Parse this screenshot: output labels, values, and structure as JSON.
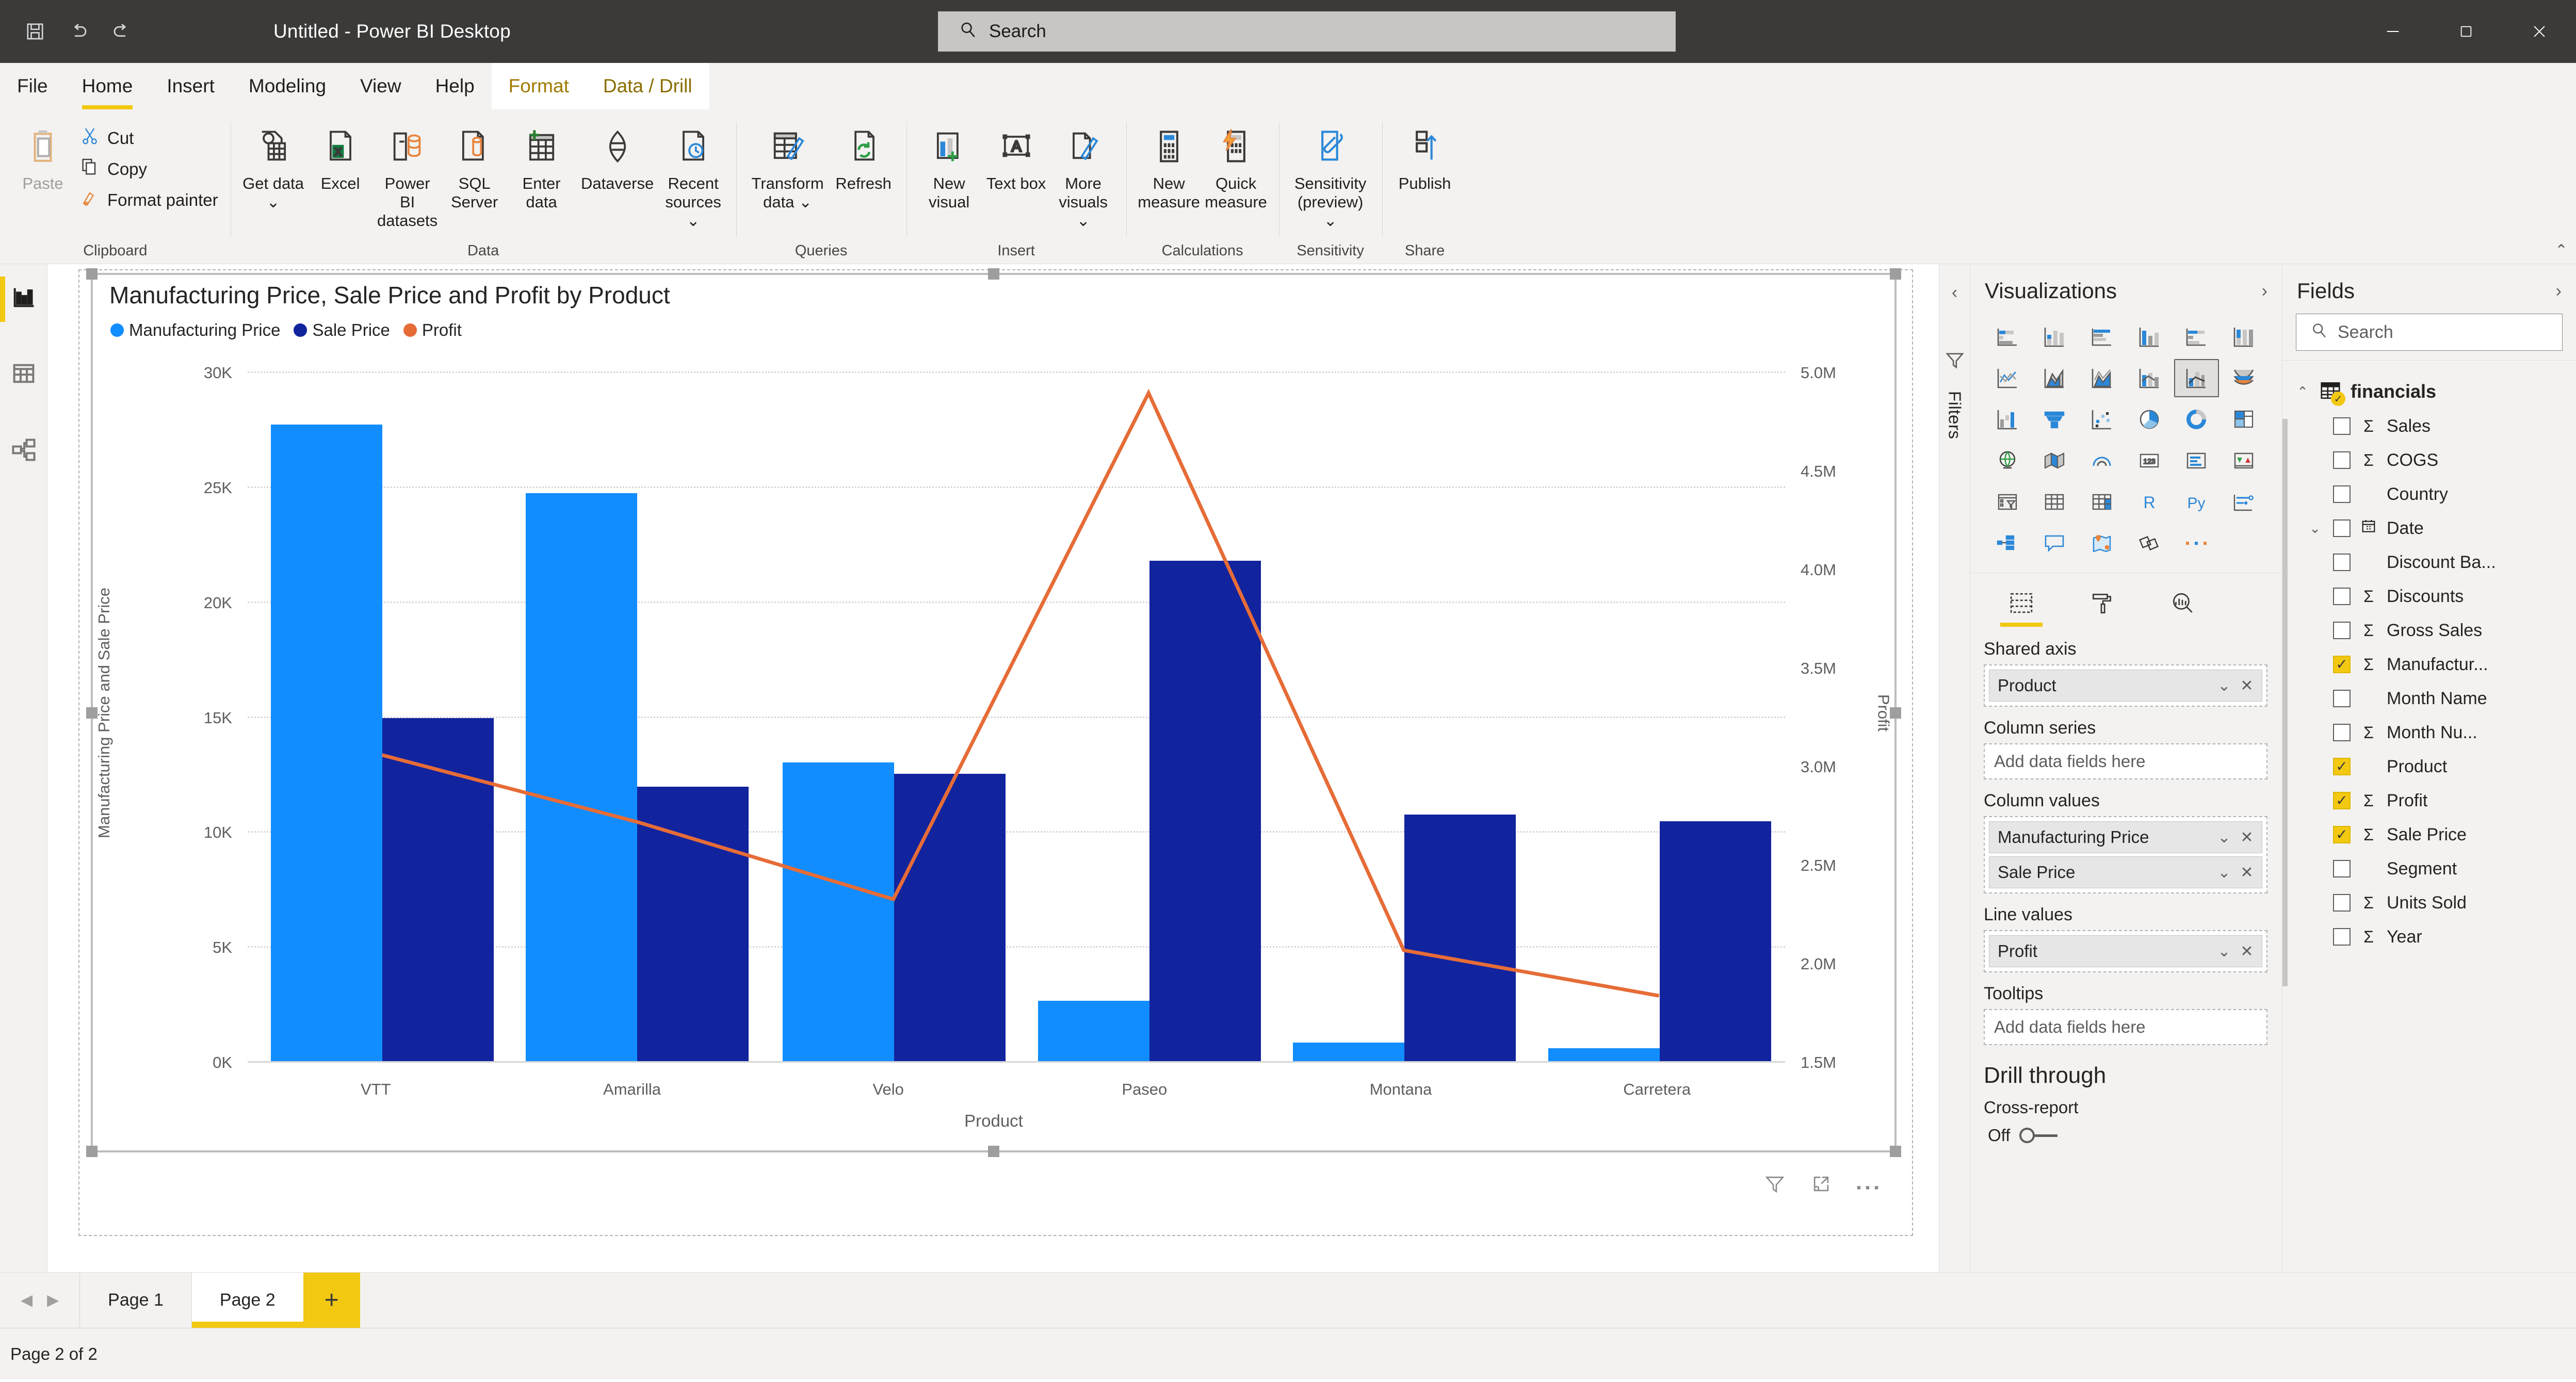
{
  "titlebar": {
    "app_title": "Untitled - Power BI Desktop",
    "save_icon": "save-icon",
    "undo_icon": "undo-icon",
    "redo_icon": "redo-icon",
    "search_placeholder": "Search",
    "minimize": "minimize-icon",
    "maximize": "maximize-icon",
    "close": "close-icon"
  },
  "ribbon_tabs": [
    {
      "label": "File",
      "state": "file"
    },
    {
      "label": "Home",
      "state": "active"
    },
    {
      "label": "Insert",
      "state": "normal"
    },
    {
      "label": "Modeling",
      "state": "normal"
    },
    {
      "label": "View",
      "state": "normal"
    },
    {
      "label": "Help",
      "state": "normal"
    },
    {
      "label": "Format",
      "state": "contextual-selected"
    },
    {
      "label": "Data / Drill",
      "state": "contextual"
    }
  ],
  "ribbon": {
    "groups": [
      {
        "name": "Clipboard",
        "label": "Clipboard",
        "big": [
          {
            "label": "Paste",
            "icon": "paste-icon",
            "disabled": true
          }
        ],
        "small": [
          {
            "label": "Cut",
            "icon": "cut-icon"
          },
          {
            "label": "Copy",
            "icon": "copy-icon"
          },
          {
            "label": "Format painter",
            "icon": "format-painter-icon"
          }
        ]
      },
      {
        "name": "Data",
        "label": "Data",
        "big": [
          {
            "label": "Get data",
            "icon": "get-data-icon",
            "caret": true
          },
          {
            "label": "Excel",
            "icon": "excel-icon"
          },
          {
            "label": "Power BI datasets",
            "icon": "powerbi-datasets-icon"
          },
          {
            "label": "SQL Server",
            "icon": "sql-server-icon"
          },
          {
            "label": "Enter data",
            "icon": "enter-data-icon"
          },
          {
            "label": "Dataverse",
            "icon": "dataverse-icon"
          },
          {
            "label": "Recent sources",
            "icon": "recent-sources-icon",
            "caret": true
          }
        ]
      },
      {
        "name": "Queries",
        "label": "Queries",
        "big": [
          {
            "label": "Transform data",
            "icon": "transform-data-icon",
            "caret": true
          },
          {
            "label": "Refresh",
            "icon": "refresh-icon"
          }
        ]
      },
      {
        "name": "Insert",
        "label": "Insert",
        "big": [
          {
            "label": "New visual",
            "icon": "new-visual-icon"
          },
          {
            "label": "Text box",
            "icon": "text-box-icon"
          },
          {
            "label": "More visuals",
            "icon": "more-visuals-icon",
            "caret": true
          }
        ]
      },
      {
        "name": "Calculations",
        "label": "Calculations",
        "big": [
          {
            "label": "New measure",
            "icon": "new-measure-icon"
          },
          {
            "label": "Quick measure",
            "icon": "quick-measure-icon"
          }
        ]
      },
      {
        "name": "Sensitivity",
        "label": "Sensitivity",
        "big": [
          {
            "label": "Sensitivity (preview)",
            "icon": "sensitivity-icon",
            "caret": true
          }
        ]
      },
      {
        "name": "Share",
        "label": "Share",
        "big": [
          {
            "label": "Publish",
            "icon": "publish-icon"
          }
        ]
      }
    ]
  },
  "left_rail": [
    {
      "name": "report-view",
      "icon": "bar-chart-icon",
      "active": true
    },
    {
      "name": "data-view",
      "icon": "table-icon",
      "active": false
    },
    {
      "name": "model-view",
      "icon": "model-relationship-icon",
      "active": false
    }
  ],
  "chart_data": {
    "type": "bar",
    "title": "Manufacturing Price, Sale Price and Profit by Product",
    "xlabel": "Product",
    "ylabel": "Manufacturing Price and Sale Price",
    "y2label": "Profit",
    "categories": [
      "VTT",
      "Amarilla",
      "Velo",
      "Paseo",
      "Montana",
      "Carretera"
    ],
    "series": [
      {
        "name": "Manufacturing Price",
        "type": "column",
        "axis": "left",
        "color": "#118dff",
        "values": [
          27750,
          24780,
          13050,
          2700,
          870,
          620
        ]
      },
      {
        "name": "Sale Price",
        "type": "column",
        "axis": "left",
        "color": "#12239e",
        "values": [
          15000,
          12000,
          12560,
          21850,
          10800,
          10500
        ]
      },
      {
        "name": "Profit",
        "type": "line",
        "axis": "right",
        "color": "#e66c37",
        "values": [
          3060000,
          2720000,
          2330000,
          4900000,
          2070000,
          1840000
        ]
      }
    ],
    "left_ticks": [
      "0K",
      "5K",
      "10K",
      "15K",
      "20K",
      "25K",
      "30K"
    ],
    "left_ylim": [
      0,
      30000
    ],
    "right_ticks": [
      "1.5M",
      "2.0M",
      "2.5M",
      "3.0M",
      "3.5M",
      "4.0M",
      "4.5M",
      "5.0M"
    ],
    "right_ylim": [
      1500000,
      5000000
    ],
    "grid": true,
    "legend_position": "top-left",
    "legend": [
      "Manufacturing Price",
      "Sale Price",
      "Profit"
    ]
  },
  "visual_toolbar": [
    {
      "name": "filter-icon"
    },
    {
      "name": "focus-mode-icon"
    },
    {
      "name": "more-options-icon"
    }
  ],
  "filters_rail": {
    "collapse_icon": "chevron-left-icon",
    "filter_icon": "filter-funnel-icon",
    "label": "Filters"
  },
  "visualizations": {
    "title": "Visualizations",
    "expand_icon": "chevron-right-icon",
    "gallery": [
      "stacked-bar-chart-icon",
      "stacked-column-chart-icon",
      "clustered-bar-chart-icon",
      "clustered-column-chart-icon",
      "100-stacked-bar-chart-icon",
      "100-stacked-column-chart-icon",
      "line-chart-icon",
      "area-chart-icon",
      "stacked-area-chart-icon",
      "line-and-stacked-column-chart-icon",
      "line-and-clustered-column-chart-icon",
      "ribbon-chart-icon",
      "waterfall-chart-icon",
      "funnel-chart-icon",
      "scatter-chart-icon",
      "pie-chart-icon",
      "donut-chart-icon",
      "treemap-icon",
      "map-icon",
      "filled-map-icon",
      "azure-map-icon",
      "card-icon",
      "multi-row-card-icon",
      "kpi-icon",
      "slicer-icon",
      "table-icon",
      "matrix-icon",
      "r-script-visual-icon",
      "python-visual-icon",
      "key-influencers-icon",
      "decomposition-tree-icon",
      "smart-narrative-icon",
      "arcgis-map-icon",
      "paginated-report-icon",
      "more-visuals-ellipsis-icon"
    ],
    "selected_gallery_index": 10,
    "modes": [
      {
        "name": "fields-pane-icon",
        "selected": true
      },
      {
        "name": "format-pane-icon",
        "selected": false
      },
      {
        "name": "analytics-pane-icon",
        "selected": false
      }
    ],
    "wells": [
      {
        "label": "Shared axis",
        "placeholder": "Add data fields here",
        "chips": [
          "Product"
        ]
      },
      {
        "label": "Column series",
        "placeholder": "Add data fields here",
        "chips": []
      },
      {
        "label": "Column values",
        "placeholder": "Add data fields here",
        "chips": [
          "Manufacturing Price",
          "Sale Price"
        ]
      },
      {
        "label": "Line values",
        "placeholder": "Add data fields here",
        "chips": [
          "Profit"
        ]
      },
      {
        "label": "Tooltips",
        "placeholder": "Add data fields here",
        "chips": []
      }
    ],
    "drill_through": {
      "heading": "Drill through",
      "cross_report_label": "Cross-report",
      "toggle_state": "Off"
    }
  },
  "fields": {
    "title": "Fields",
    "expand_icon": "chevron-right-icon",
    "search_placeholder": "Search",
    "search_icon": "search-icon",
    "table": {
      "name": "financials",
      "expanded": true,
      "icon": "table-badge-icon"
    },
    "items": [
      {
        "label": "Sales",
        "checked": false,
        "sigma": true,
        "icon": null,
        "expandable": false
      },
      {
        "label": "COGS",
        "checked": false,
        "sigma": true,
        "icon": null,
        "expandable": false
      },
      {
        "label": "Country",
        "checked": false,
        "sigma": false,
        "icon": null,
        "expandable": false
      },
      {
        "label": "Date",
        "checked": false,
        "sigma": false,
        "icon": "calendar-icon",
        "expandable": true
      },
      {
        "label": "Discount Ba...",
        "checked": false,
        "sigma": false,
        "icon": null,
        "expandable": false
      },
      {
        "label": "Discounts",
        "checked": false,
        "sigma": true,
        "icon": null,
        "expandable": false
      },
      {
        "label": "Gross Sales",
        "checked": false,
        "sigma": true,
        "icon": null,
        "expandable": false
      },
      {
        "label": "Manufactur...",
        "checked": true,
        "sigma": true,
        "icon": null,
        "expandable": false
      },
      {
        "label": "Month Name",
        "checked": false,
        "sigma": false,
        "icon": null,
        "expandable": false
      },
      {
        "label": "Month Nu...",
        "checked": false,
        "sigma": true,
        "icon": null,
        "expandable": false
      },
      {
        "label": "Product",
        "checked": true,
        "sigma": false,
        "icon": null,
        "expandable": false
      },
      {
        "label": "Profit",
        "checked": true,
        "sigma": true,
        "icon": null,
        "expandable": false
      },
      {
        "label": "Sale Price",
        "checked": true,
        "sigma": true,
        "icon": null,
        "expandable": false
      },
      {
        "label": "Segment",
        "checked": false,
        "sigma": false,
        "icon": null,
        "expandable": false
      },
      {
        "label": "Units Sold",
        "checked": false,
        "sigma": true,
        "icon": null,
        "expandable": false
      },
      {
        "label": "Year",
        "checked": false,
        "sigma": true,
        "icon": null,
        "expandable": false
      }
    ]
  },
  "footer": {
    "prev_icon": "page-prev-icon",
    "next_icon": "page-next-icon",
    "tabs": [
      {
        "label": "Page 1",
        "active": false
      },
      {
        "label": "Page 2",
        "active": true
      }
    ],
    "add_label": "+",
    "status": "Page 2 of 2"
  },
  "colors": {
    "accent": "#f2c811",
    "manufacturing_price": "#118dff",
    "sale_price": "#12239e",
    "profit": "#e66c37",
    "chrome": "#f3f2f1",
    "titlebar": "#3b3a39"
  }
}
